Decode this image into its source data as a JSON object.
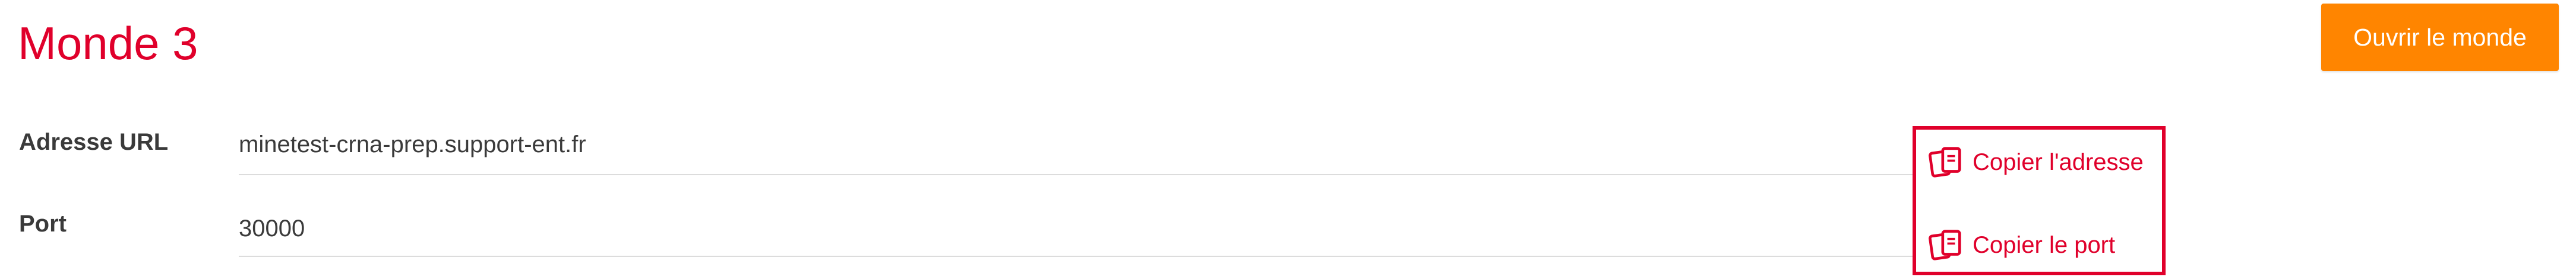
{
  "world": {
    "title": "Monde 3",
    "open_button_label": "Ouvrir le monde"
  },
  "fields": {
    "url": {
      "label": "Adresse URL",
      "value": "minetest-crna-prep.support-ent.fr"
    },
    "port": {
      "label": "Port",
      "value": "30000"
    }
  },
  "actions": {
    "copy_address_label": "Copier l'adresse",
    "copy_port_label": "Copier le port",
    "icon": "copy-icon"
  },
  "colors": {
    "accent": "#e0002b",
    "button": "#ff8500",
    "text": "#3a3a3a",
    "divider": "#dcdcdc"
  }
}
